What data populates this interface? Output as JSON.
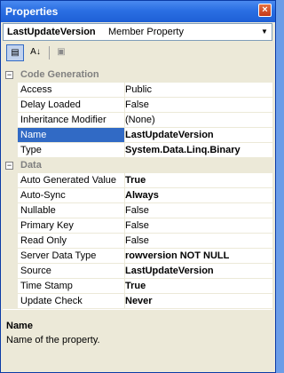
{
  "window": {
    "title": "Properties",
    "close_icon": "×"
  },
  "object_selector": {
    "name": "LastUpdateVersion",
    "type": "Member Property",
    "arrow": "▼"
  },
  "toolbar": {
    "categorized_icon": "▤",
    "alphabetical_icon": "A↓",
    "property_pages_icon": "▣"
  },
  "grid": {
    "code_generation": {
      "label": "Code Generation",
      "toggle": "−",
      "rows": [
        {
          "name": "Access",
          "value": "Public",
          "bold": false
        },
        {
          "name": "Delay Loaded",
          "value": "False",
          "bold": false
        },
        {
          "name": "Inheritance Modifier",
          "value": "(None)",
          "bold": false
        },
        {
          "name": "Name",
          "value": "LastUpdateVersion",
          "bold": true,
          "selected": true
        },
        {
          "name": "Type",
          "value": "System.Data.Linq.Binary",
          "bold": true
        }
      ]
    },
    "data": {
      "label": "Data",
      "toggle": "−",
      "rows": [
        {
          "name": "Auto Generated Value",
          "value": "True",
          "bold": true
        },
        {
          "name": "Auto-Sync",
          "value": "Always",
          "bold": true
        },
        {
          "name": "Nullable",
          "value": "False",
          "bold": false
        },
        {
          "name": "Primary Key",
          "value": "False",
          "bold": false
        },
        {
          "name": "Read Only",
          "value": "False",
          "bold": false
        },
        {
          "name": "Server Data Type",
          "value": "rowversion NOT NULL",
          "bold": true
        },
        {
          "name": "Source",
          "value": "LastUpdateVersion",
          "bold": true
        },
        {
          "name": "Time Stamp",
          "value": "True",
          "bold": true
        },
        {
          "name": "Update Check",
          "value": "Never",
          "bold": true
        }
      ]
    }
  },
  "description": {
    "title": "Name",
    "text": "Name of the property."
  }
}
